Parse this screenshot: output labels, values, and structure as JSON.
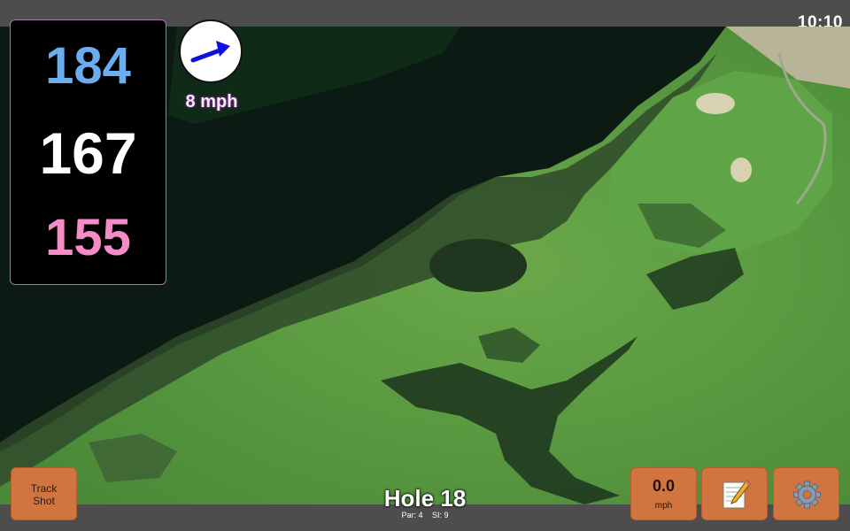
{
  "status": {
    "time": "10:10"
  },
  "distances": {
    "back": "184",
    "middle": "167",
    "front": "155"
  },
  "wind": {
    "speed_label": "8 mph",
    "arrow_color": "#1010e0"
  },
  "hole": {
    "title": "Hole 18",
    "par": "Par: 4",
    "si": "SI: 9"
  },
  "buttons": {
    "track_shot": "Track\nShot",
    "speed_value": "0.0",
    "speed_unit": "mph",
    "notes_icon": "notepad-pencil-icon",
    "settings_icon": "gear-icon"
  },
  "colors": {
    "back_distance": "#6aaef0",
    "middle_distance": "#ffffff",
    "front_distance": "#f58cc8",
    "button": "#d2743f",
    "bar": "#4d4d4d"
  }
}
